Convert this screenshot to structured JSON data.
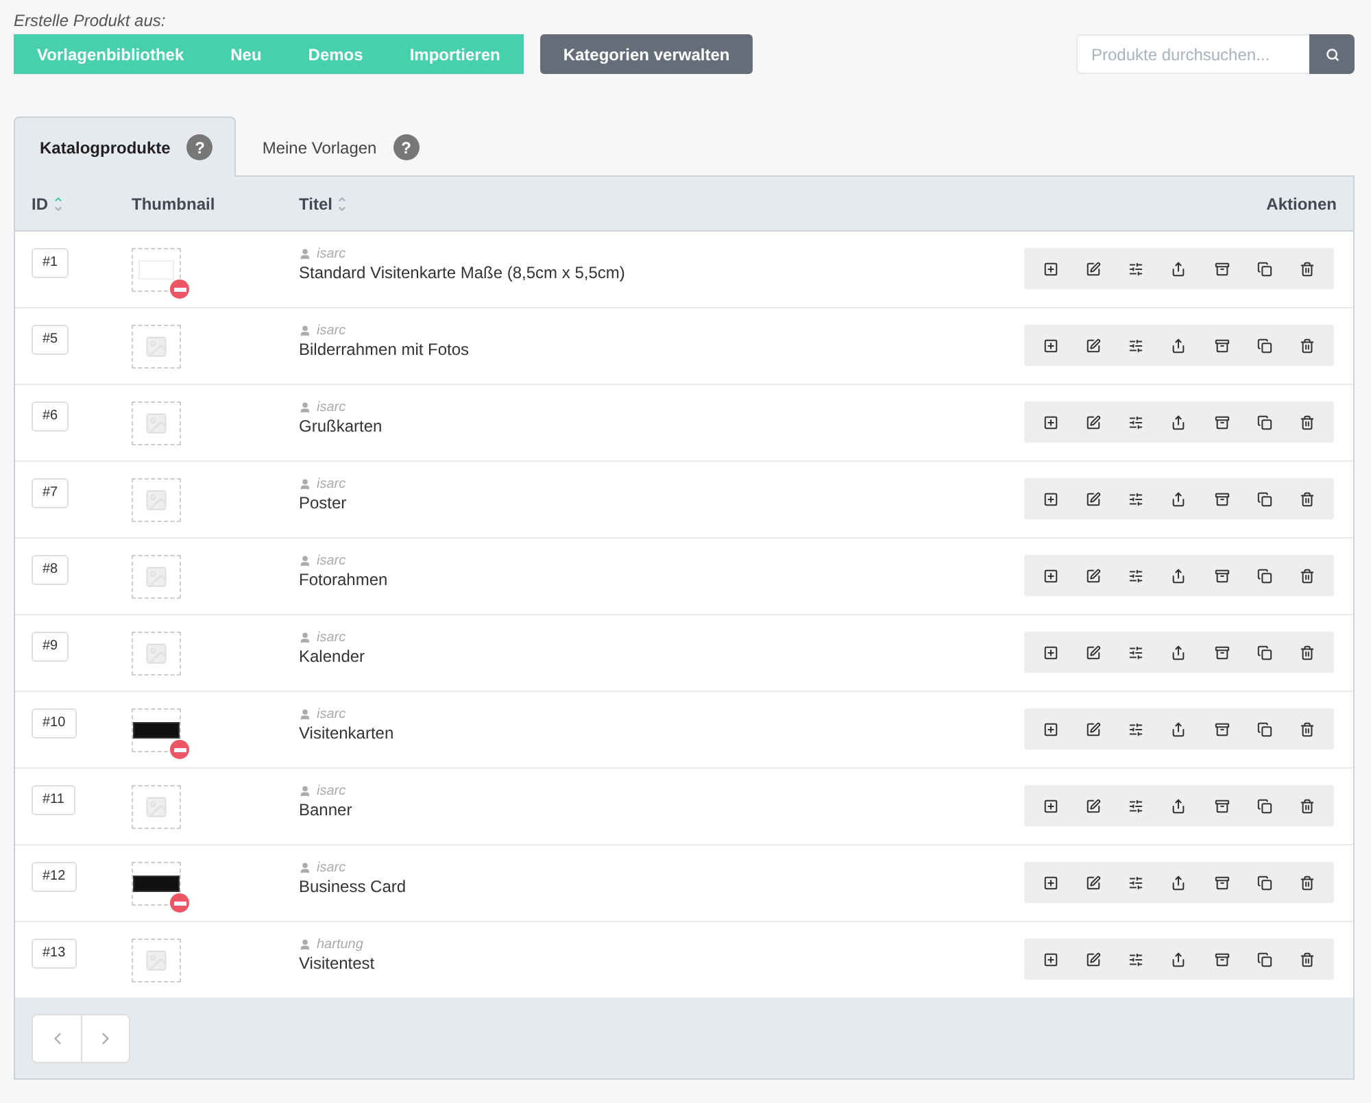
{
  "create_label": "Erstelle Produkt aus:",
  "create_buttons": [
    "Vorlagenbibliothek",
    "Neu",
    "Demos",
    "Importieren"
  ],
  "manage_button": "Kategorien verwalten",
  "search": {
    "placeholder": "Produkte durchsuchen..."
  },
  "tabs": [
    {
      "label": "Katalogprodukte",
      "help": "?",
      "selected": true
    },
    {
      "label": "Meine Vorlagen",
      "help": "?",
      "selected": false
    }
  ],
  "table": {
    "columns": [
      {
        "label": "ID",
        "sortable": true,
        "sorted": true
      },
      {
        "label": "Thumbnail"
      },
      {
        "label": "Titel",
        "sortable": true,
        "sorted": false
      },
      {
        "label": "Aktionen"
      }
    ],
    "rows": [
      {
        "id": "#1",
        "thumbnail": {
          "kind": "light-card"
        },
        "blocked": true,
        "author": "isarc",
        "title": "Standard Visitenkarte Maße (8,5cm x 5,5cm)"
      },
      {
        "id": "#5",
        "thumbnail": {
          "kind": "placeholder"
        },
        "blocked": false,
        "author": "isarc",
        "title": "Bilderrahmen mit Fotos"
      },
      {
        "id": "#6",
        "thumbnail": {
          "kind": "placeholder"
        },
        "blocked": false,
        "author": "isarc",
        "title": "Grußkarten"
      },
      {
        "id": "#7",
        "thumbnail": {
          "kind": "placeholder"
        },
        "blocked": false,
        "author": "isarc",
        "title": "Poster"
      },
      {
        "id": "#8",
        "thumbnail": {
          "kind": "placeholder"
        },
        "blocked": false,
        "author": "isarc",
        "title": "Fotorahmen"
      },
      {
        "id": "#9",
        "thumbnail": {
          "kind": "placeholder"
        },
        "blocked": false,
        "author": "isarc",
        "title": "Kalender"
      },
      {
        "id": "#10",
        "thumbnail": {
          "kind": "dark-card"
        },
        "blocked": true,
        "author": "isarc",
        "title": "Visitenkarten"
      },
      {
        "id": "#11",
        "thumbnail": {
          "kind": "placeholder"
        },
        "blocked": false,
        "author": "isarc",
        "title": "Banner"
      },
      {
        "id": "#12",
        "thumbnail": {
          "kind": "dark-card"
        },
        "blocked": true,
        "author": "isarc",
        "title": "Business Card"
      },
      {
        "id": "#13",
        "thumbnail": {
          "kind": "placeholder"
        },
        "blocked": false,
        "author": "hartung",
        "title": "Visitentest"
      }
    ]
  }
}
